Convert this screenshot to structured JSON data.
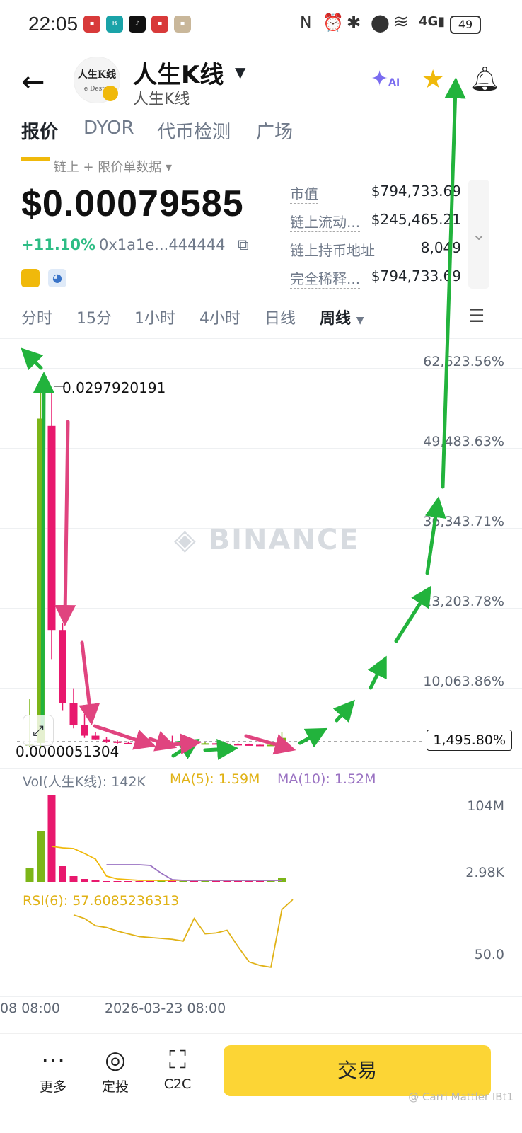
{
  "status_bar": {
    "time": "22:05",
    "battery": "49",
    "app_icons": [
      "huawei-icon",
      "boss-icon",
      "tiktok-icon",
      "huawei-icon",
      "photo-icon"
    ],
    "indicator_icons": [
      "nfc-icon",
      "alarm-icon",
      "bluetooth-icon",
      "location-icon",
      "wifi-icon",
      "signal-4g-icon"
    ]
  },
  "header": {
    "token_name": "人生K线",
    "token_sub": "人生K线",
    "logo_line1": "人生K线",
    "logo_line2": "e Destir",
    "ai_label": "AI"
  },
  "tabs": [
    "报价",
    "DYOR",
    "代币检测",
    "广场"
  ],
  "price_panel": {
    "subline": "链上 + 限价单数据",
    "price": "$0.00079585",
    "change": "+11.10%",
    "address": "0x1a1e...444444",
    "stats": [
      {
        "label": "市值",
        "value": "$794,733.69"
      },
      {
        "label": "链上流动...",
        "value": "$245,465.21"
      },
      {
        "label": "链上持币地址",
        "value": "8,049"
      },
      {
        "label": "完全稀释...",
        "value": "$794,733.69"
      }
    ]
  },
  "intervals": [
    "分时",
    "15分",
    "1小时",
    "4小时",
    "日线",
    "周线"
  ],
  "chart": {
    "watermark": "BINANCE",
    "y_labels": [
      "62,623.56%",
      "49,483.63%",
      "36,343.71%",
      "23,203.78%",
      "10,063.86%"
    ],
    "current_label": "1,495.80%",
    "high_label": "0.0297920191",
    "low_label": "0.0000051304",
    "vol_label": "Vol(人生K线): 142K",
    "ma5_label": "MA(5): 1.59M",
    "ma10_label": "MA(10): 1.52M",
    "vol_y_labels": [
      "104M",
      "2.98K"
    ],
    "rsi_label": "RSI(6): 57.6085236313",
    "rsi_y_label": "50.0",
    "x_labels": [
      "08 08:00",
      "2026-03-23 08:00"
    ],
    "colors": {
      "up": "#7cb518",
      "down": "#e8186d",
      "ma5": "#f0b90b",
      "ma10": "#9a72c2",
      "arrow_green": "#22b33c",
      "arrow_pink": "#e0447f"
    }
  },
  "chart_data": {
    "type": "candlestick",
    "title": "人生K线",
    "y_axis_labels": [
      "62,623.56%",
      "49,483.63%",
      "36,343.71%",
      "23,203.78%",
      "10,063.86%",
      "1,495.80%"
    ],
    "x_labels": [
      "08 08:00",
      "2026-03-23 08:00"
    ],
    "candles": [
      {
        "o": 0.2,
        "h": 6.5,
        "l": 0,
        "c": 0.3,
        "dir": "up"
      },
      {
        "o": 0.5,
        "h": 50,
        "l": 0,
        "c": 45,
        "dir": "up"
      },
      {
        "o": 44,
        "h": 49,
        "l": 12,
        "c": 16,
        "dir": "down"
      },
      {
        "o": 16,
        "h": 17,
        "l": 5,
        "c": 6,
        "dir": "down"
      },
      {
        "o": 6,
        "h": 8,
        "l": 2.5,
        "c": 3,
        "dir": "down"
      },
      {
        "o": 3,
        "h": 4.5,
        "l": 1.2,
        "c": 1.5,
        "dir": "down"
      },
      {
        "o": 1.5,
        "h": 2.0,
        "l": 0.9,
        "c": 1.0,
        "dir": "down"
      },
      {
        "o": 1.0,
        "h": 1.3,
        "l": 0.5,
        "c": 0.7,
        "dir": "down"
      },
      {
        "o": 0.7,
        "h": 0.9,
        "l": 0.4,
        "c": 0.5,
        "dir": "down"
      },
      {
        "o": 0.5,
        "h": 0.7,
        "l": 0.4,
        "c": 0.45,
        "dir": "down"
      },
      {
        "o": 0.45,
        "h": 0.6,
        "l": 0.35,
        "c": 0.4,
        "dir": "down"
      },
      {
        "o": 0.4,
        "h": 0.6,
        "l": 0.3,
        "c": 0.35,
        "dir": "down"
      },
      {
        "o": 0.35,
        "h": 0.6,
        "l": 0.3,
        "c": 0.5,
        "dir": "up"
      },
      {
        "o": 0.5,
        "h": 1.5,
        "l": 0.3,
        "c": 0.4,
        "dir": "down"
      },
      {
        "o": 0.4,
        "h": 0.7,
        "l": 0.3,
        "c": 0.5,
        "dir": "up"
      },
      {
        "o": 0.5,
        "h": 0.6,
        "l": 0.35,
        "c": 0.4,
        "dir": "down"
      },
      {
        "o": 0.4,
        "h": 0.6,
        "l": 0.3,
        "c": 0.45,
        "dir": "up"
      },
      {
        "o": 0.45,
        "h": 0.5,
        "l": 0.35,
        "c": 0.4,
        "dir": "down"
      },
      {
        "o": 0.4,
        "h": 0.5,
        "l": 0.3,
        "c": 0.35,
        "dir": "down"
      },
      {
        "o": 0.35,
        "h": 0.45,
        "l": 0.3,
        "c": 0.3,
        "dir": "down"
      },
      {
        "o": 0.3,
        "h": 0.4,
        "l": 0.2,
        "c": 0.25,
        "dir": "down"
      },
      {
        "o": 0.25,
        "h": 0.35,
        "l": 0.15,
        "c": 0.2,
        "dir": "down"
      },
      {
        "o": 0.2,
        "h": 0.3,
        "l": 0.15,
        "c": 0.25,
        "dir": "up"
      },
      {
        "o": 0.25,
        "h": 2.0,
        "l": 0.2,
        "c": 1.2,
        "dir": "up"
      }
    ],
    "volume": {
      "bars": [
        {
          "v": 20,
          "dir": "up"
        },
        {
          "v": 72,
          "dir": "up"
        },
        {
          "v": 122,
          "dir": "down"
        },
        {
          "v": 22,
          "dir": "down"
        },
        {
          "v": 8,
          "dir": "down"
        },
        {
          "v": 4,
          "dir": "down"
        },
        {
          "v": 3,
          "dir": "down"
        },
        {
          "v": 1,
          "dir": "down"
        },
        {
          "v": 1,
          "dir": "down"
        },
        {
          "v": 1,
          "dir": "down"
        },
        {
          "v": 1,
          "dir": "down"
        },
        {
          "v": 1,
          "dir": "down"
        },
        {
          "v": 2,
          "dir": "up"
        },
        {
          "v": 3,
          "dir": "down"
        },
        {
          "v": 1,
          "dir": "up"
        },
        {
          "v": 1,
          "dir": "down"
        },
        {
          "v": 1,
          "dir": "up"
        },
        {
          "v": 1,
          "dir": "down"
        },
        {
          "v": 1,
          "dir": "down"
        },
        {
          "v": 1,
          "dir": "down"
        },
        {
          "v": 1,
          "dir": "down"
        },
        {
          "v": 1,
          "dir": "down"
        },
        {
          "v": 1,
          "dir": "up"
        },
        {
          "v": 5,
          "dir": "up"
        }
      ],
      "ma5": [
        null,
        null,
        50,
        48,
        47,
        40,
        32,
        8,
        4,
        3,
        2,
        2,
        2,
        2,
        2,
        2,
        2,
        2,
        2,
        2,
        2,
        2,
        2,
        2
      ],
      "ma10": [
        null,
        null,
        null,
        null,
        null,
        null,
        null,
        24,
        24,
        24,
        24,
        23,
        12,
        3,
        2,
        2,
        2,
        2,
        2,
        2,
        2,
        2,
        2,
        2
      ]
    },
    "rsi": [
      null,
      null,
      null,
      null,
      84,
      80,
      72,
      70,
      66,
      63,
      60,
      59,
      58,
      57,
      55,
      80,
      63,
      64,
      67,
      49,
      32,
      28,
      26,
      90,
      101
    ],
    "annotations": "hand-drawn arrows: green arrows up from low to peak, pink arrows down along the decline, green arrows rising toward the star icon"
  },
  "bottom_bar": {
    "buttons": [
      {
        "label": "更多",
        "icon": "more-icon"
      },
      {
        "label": "定投",
        "icon": "recurring-icon"
      },
      {
        "label": "C2C",
        "icon": "c2c-icon"
      }
    ],
    "trade_label": "交易",
    "credit": "@ Carri Mattler IBt1"
  }
}
